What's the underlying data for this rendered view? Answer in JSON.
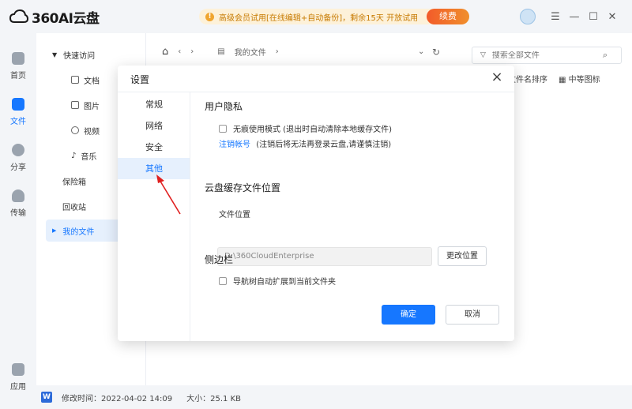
{
  "app": {
    "logo_text": "360AI云盘"
  },
  "promo": {
    "text": "高级会员试用[在线编辑+自动备份]，剩余15天  开放试用",
    "button": "续费"
  },
  "rail": [
    {
      "label": "首页",
      "icon": "home-icon"
    },
    {
      "label": "文件",
      "icon": "folder-icon"
    },
    {
      "label": "分享",
      "icon": "share-icon"
    },
    {
      "label": "传输",
      "icon": "transfer-icon"
    },
    {
      "label": "应用",
      "icon": "apps-icon"
    }
  ],
  "tree": {
    "quick_access": "快速访问",
    "items": [
      "文档",
      "图片",
      "视频",
      "音乐"
    ],
    "vault": "保险箱",
    "recycle": "回收站",
    "my_files": "我的文件"
  },
  "toolbar": {
    "breadcrumb": "我的文件",
    "search_placeholder": "搜索全部文件",
    "sort": "按文件名排序",
    "view": "中等图标"
  },
  "status": {
    "modified": "修改时间：2022-04-02 14:09",
    "size": "大小：25.1 KB"
  },
  "dialog": {
    "title": "设置",
    "tabs": [
      "常规",
      "网络",
      "安全",
      "其他"
    ],
    "privacy_title": "用户隐私",
    "privacy_check": "无痕使用模式 (退出时自动清除本地缓存文件)",
    "logout_link": "注销帐号",
    "logout_note": "(注销后将无法再登录云盘,请谨慎注销)",
    "cache_title": "云盘缓存文件位置",
    "path_label": "文件位置",
    "path_value": "D:\\360CloudEnterprise",
    "change_button": "更改位置",
    "sidebar_title": "侧边栏",
    "sidebar_check": "导航树自动扩展到当前文件夹",
    "ok_button": "确定",
    "cancel_button": "取消"
  },
  "colors": {
    "accent": "#1677ff",
    "annotation": "#e02020"
  }
}
